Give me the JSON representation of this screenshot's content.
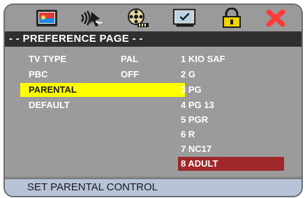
{
  "title": "- - PREFERENCE PAGE - -",
  "toolbar_icons": [
    "monitor-icon",
    "audio-icon",
    "video-reel-icon",
    "checklist-icon",
    "lock-icon",
    "close-icon"
  ],
  "settings": [
    {
      "label": "TV TYPE",
      "value": "PAL"
    },
    {
      "label": "PBC",
      "value": "OFF"
    },
    {
      "label": "PARENTAL",
      "value": ""
    },
    {
      "label": "DEFAULT",
      "value": ""
    }
  ],
  "selected_setting": "PARENTAL",
  "options": [
    "1 KIO SAF",
    "2 G",
    "3 PG",
    "4 PG 13",
    "5 PGR",
    "6 R",
    "7 NC17",
    "8 ADULT"
  ],
  "selected_option": "8 ADULT",
  "status": "SET PARENTAL CONTROL",
  "colors": {
    "frame": "#8b8b8b",
    "title_bar": "#2f2f2f",
    "main_bg": "#9b9b9b",
    "selected_setting": "#ffff00",
    "selected_option": "#a0282a",
    "status_bar": "#b7c3d6"
  }
}
